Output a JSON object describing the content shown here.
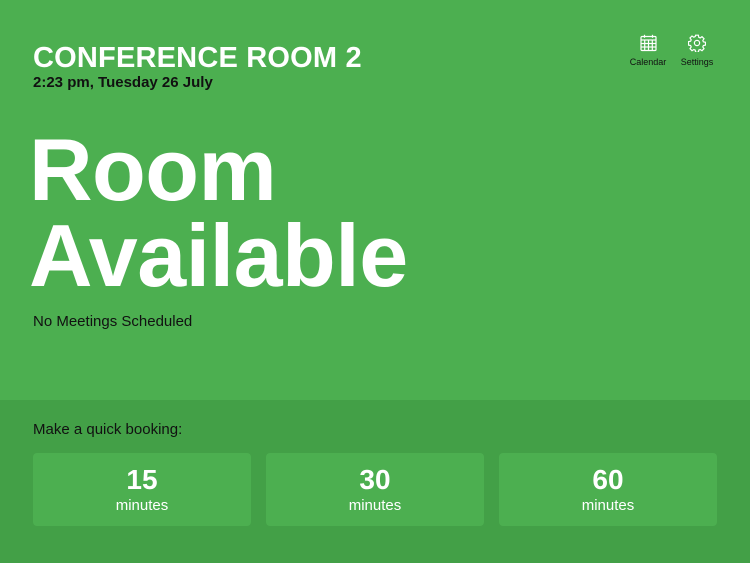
{
  "room": {
    "name": "CONFERENCE ROOM 2",
    "datetime": "2:23 pm, Tuesday 26 July"
  },
  "status": {
    "line1": "Room",
    "line2": "Available",
    "meetings": "No Meetings Scheduled"
  },
  "toolbar": {
    "calendar_label": "Calendar",
    "settings_label": "Settings",
    "calendar_icon": "calendar-icon",
    "settings_icon": "gear-icon"
  },
  "quick_booking": {
    "label": "Make a quick booking:",
    "options": [
      {
        "value": "15",
        "unit": "minutes"
      },
      {
        "value": "30",
        "unit": "minutes"
      },
      {
        "value": "60",
        "unit": "minutes"
      }
    ]
  },
  "colors": {
    "available_green": "#4caf50",
    "booking_panel_green": "#43a047"
  }
}
